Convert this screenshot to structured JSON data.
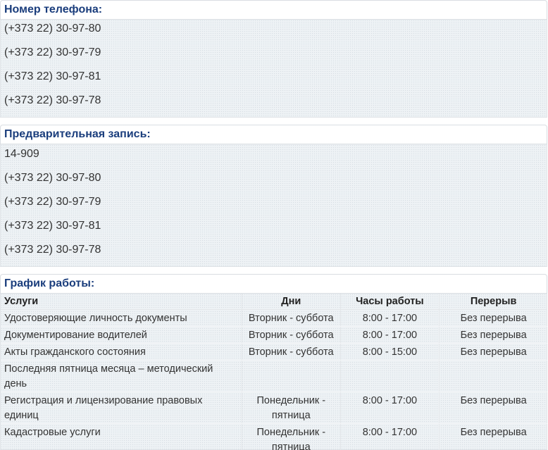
{
  "phone_section": {
    "title": "Номер телефона:",
    "numbers": [
      "(+373 22) 30-97-80",
      "(+373 22) 30-97-79",
      "(+373 22) 30-97-81",
      "(+373 22) 30-97-78"
    ]
  },
  "appointment_section": {
    "title": "Предварительная запись:",
    "numbers": [
      "14-909",
      "(+373 22) 30-97-80",
      "(+373 22) 30-97-79",
      "(+373 22) 30-97-81",
      "(+373 22) 30-97-78"
    ]
  },
  "schedule_section": {
    "title": "График работы:",
    "columns": [
      "Услуги",
      "Дни",
      "Часы работы",
      "Перерыв"
    ],
    "rows": [
      {
        "service": "Удостоверяющие личность документы",
        "days": "Вторник - суббота",
        "hours": "8:00 - 17:00",
        "break": "Без перерыва"
      },
      {
        "service": "Документирование водителей",
        "days": "Вторник - суббота",
        "hours": "8:00 - 17:00",
        "break": "Без перерыва"
      },
      {
        "service": "Акты гражданского состояния",
        "days": "Вторник - суббота",
        "hours": "8:00 - 15:00",
        "break": "Без перерыва"
      },
      {
        "service": "Последняя пятница месяца – методический день",
        "days": "",
        "hours": "",
        "break": ""
      },
      {
        "service": "Регистрация и лицензирование правовых единиц",
        "days": "Понедельник - пятница",
        "hours": "8:00 - 17:00",
        "break": "Без перерыва"
      },
      {
        "service": "Кадастровые услуги",
        "days": "Понедельник - пятница",
        "hours": "8:00 - 17:00",
        "break": "Без перерыва"
      }
    ]
  }
}
